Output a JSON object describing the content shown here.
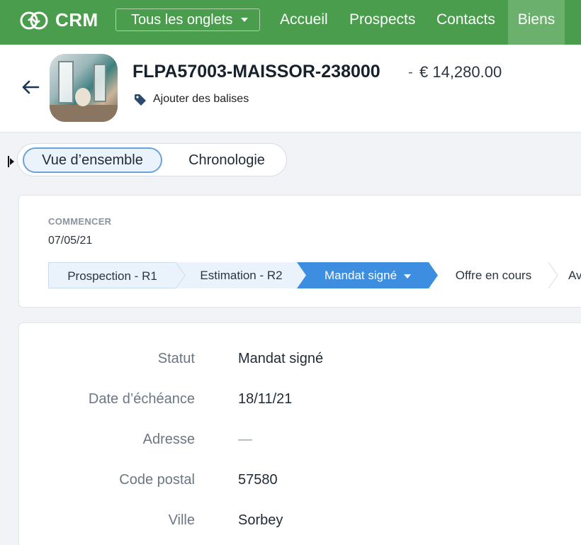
{
  "app": {
    "logo_text": "CRM",
    "tabs_dropdown": "Tous les onglets",
    "nav": [
      "Accueil",
      "Prospects",
      "Contacts",
      "Biens"
    ],
    "active_nav": "Biens"
  },
  "record": {
    "title": "FLPA57003-MAISSOR-238000",
    "separator": "-",
    "price": "€ 14,280.00",
    "tags_link": "Ajouter des balises"
  },
  "view_toggle": {
    "overview": "Vue d’ensemble",
    "timeline": "Chronologie",
    "selected": "Vue d’ensemble"
  },
  "stage": {
    "start_label": "COMMENCER",
    "start_date": "07/05/21",
    "stages": [
      "Prospection - R1",
      "Estimation - R2",
      "Mandat signé",
      "Offre en cours",
      "Avan"
    ],
    "current": "Mandat signé"
  },
  "details": [
    {
      "label": "Statut",
      "value": "Mandat signé"
    },
    {
      "label": "Date d’échéance",
      "value": "18/11/21"
    },
    {
      "label": "Adresse",
      "value": "—"
    },
    {
      "label": "Code postal",
      "value": "57580"
    },
    {
      "label": "Ville",
      "value": "Sorbey"
    }
  ],
  "colors": {
    "topbar": "#4a9d4c",
    "active_nav": "#6cb06e",
    "active_stage": "#3d8ee0",
    "completed_stage": "#eaf3fb"
  }
}
